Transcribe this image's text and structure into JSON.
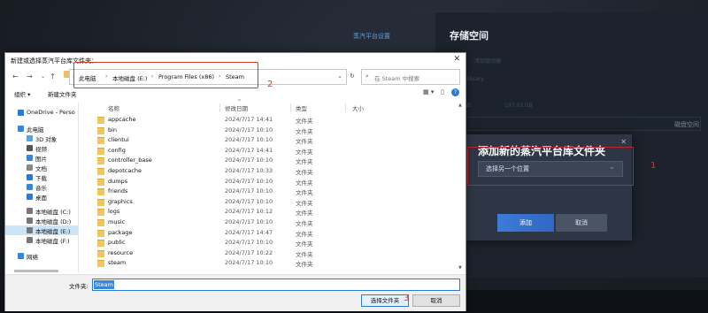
{
  "steam": {
    "nav_title": "蒸汽平台设置",
    "page_title": "存储空间",
    "faint_add_drive": "添加驱动器",
    "faint_name": "Steamlibrary",
    "faint_size1": "9.96 GB",
    "faint_size2": "193.03 GB",
    "faint_storage": "磁盘空间",
    "dialog_title": "添加新的蒸汽平台库文件夹",
    "select_value": "选择另一个位置",
    "add_label": "添加",
    "cancel_label": "取消",
    "annotation_1": "1"
  },
  "file_dialog": {
    "title": "新建或选择蒸汽平台库文件夹：",
    "address": [
      "此电脑",
      "本地磁盘 (E:)",
      "Program Files (x86)",
      "Steam"
    ],
    "search_placeholder": "在 Steam 中搜索",
    "organize_label": "组织 ▾",
    "new_folder_label": "新建文件夹",
    "annotation_2": "2",
    "annotation_3": "3",
    "sidebar": [
      {
        "label": "OneDrive - Perso",
        "icon": "cloud-icon",
        "color": "#2b78d6"
      },
      {
        "label": "此电脑",
        "icon": "computer-icon",
        "color": "#3a86d6"
      },
      {
        "label": "3D 对象",
        "icon": "cube-icon",
        "color": "#5aa0e6"
      },
      {
        "label": "视频",
        "icon": "video-icon",
        "color": "#555555"
      },
      {
        "label": "图片",
        "icon": "picture-icon",
        "color": "#3a86d6"
      },
      {
        "label": "文档",
        "icon": "document-icon",
        "color": "#888888"
      },
      {
        "label": "下载",
        "icon": "download-icon",
        "color": "#2b78d6"
      },
      {
        "label": "音乐",
        "icon": "music-icon",
        "color": "#3a86d6"
      },
      {
        "label": "桌面",
        "icon": "desktop-icon",
        "color": "#2b78d6"
      },
      {
        "label": "本地磁盘 (C:)",
        "icon": "drive-icon",
        "color": "#777777"
      },
      {
        "label": "本地磁盘 (D:)",
        "icon": "drive-icon",
        "color": "#777777"
      },
      {
        "label": "本地磁盘 (E:)",
        "icon": "drive-icon",
        "color": "#777777",
        "selected": true
      },
      {
        "label": "本地磁盘 (F:)",
        "icon": "drive-icon",
        "color": "#777777"
      },
      {
        "label": "网络",
        "icon": "network-icon",
        "color": "#3a86d6"
      }
    ],
    "columns": {
      "name": "名称",
      "date": "修改日期",
      "type": "类型",
      "size": "大小"
    },
    "rows": [
      {
        "name": "appcache",
        "date": "2024/7/17 14:41",
        "type": "文件夹"
      },
      {
        "name": "bin",
        "date": "2024/7/17 10:10",
        "type": "文件夹"
      },
      {
        "name": "clientui",
        "date": "2024/7/17 10:10",
        "type": "文件夹"
      },
      {
        "name": "config",
        "date": "2024/7/17 14:41",
        "type": "文件夹"
      },
      {
        "name": "controller_base",
        "date": "2024/7/17 10:10",
        "type": "文件夹"
      },
      {
        "name": "depotcache",
        "date": "2024/7/17 10:33",
        "type": "文件夹"
      },
      {
        "name": "dumps",
        "date": "2024/7/17 10:10",
        "type": "文件夹"
      },
      {
        "name": "friends",
        "date": "2024/7/17 10:10",
        "type": "文件夹"
      },
      {
        "name": "graphics",
        "date": "2024/7/17 10:10",
        "type": "文件夹"
      },
      {
        "name": "logs",
        "date": "2024/7/17 10:12",
        "type": "文件夹"
      },
      {
        "name": "music",
        "date": "2024/7/17 10:10",
        "type": "文件夹"
      },
      {
        "name": "package",
        "date": "2024/7/17 14:47",
        "type": "文件夹"
      },
      {
        "name": "public",
        "date": "2024/7/17 10:10",
        "type": "文件夹"
      },
      {
        "name": "resource",
        "date": "2024/7/17 10:22",
        "type": "文件夹"
      },
      {
        "name": "steam",
        "date": "2024/7/17 10:10",
        "type": "文件夹"
      }
    ],
    "filename_label": "文件夹:",
    "filename_value": "Steam",
    "select_button": "选择文件夹",
    "cancel_button": "取消"
  }
}
